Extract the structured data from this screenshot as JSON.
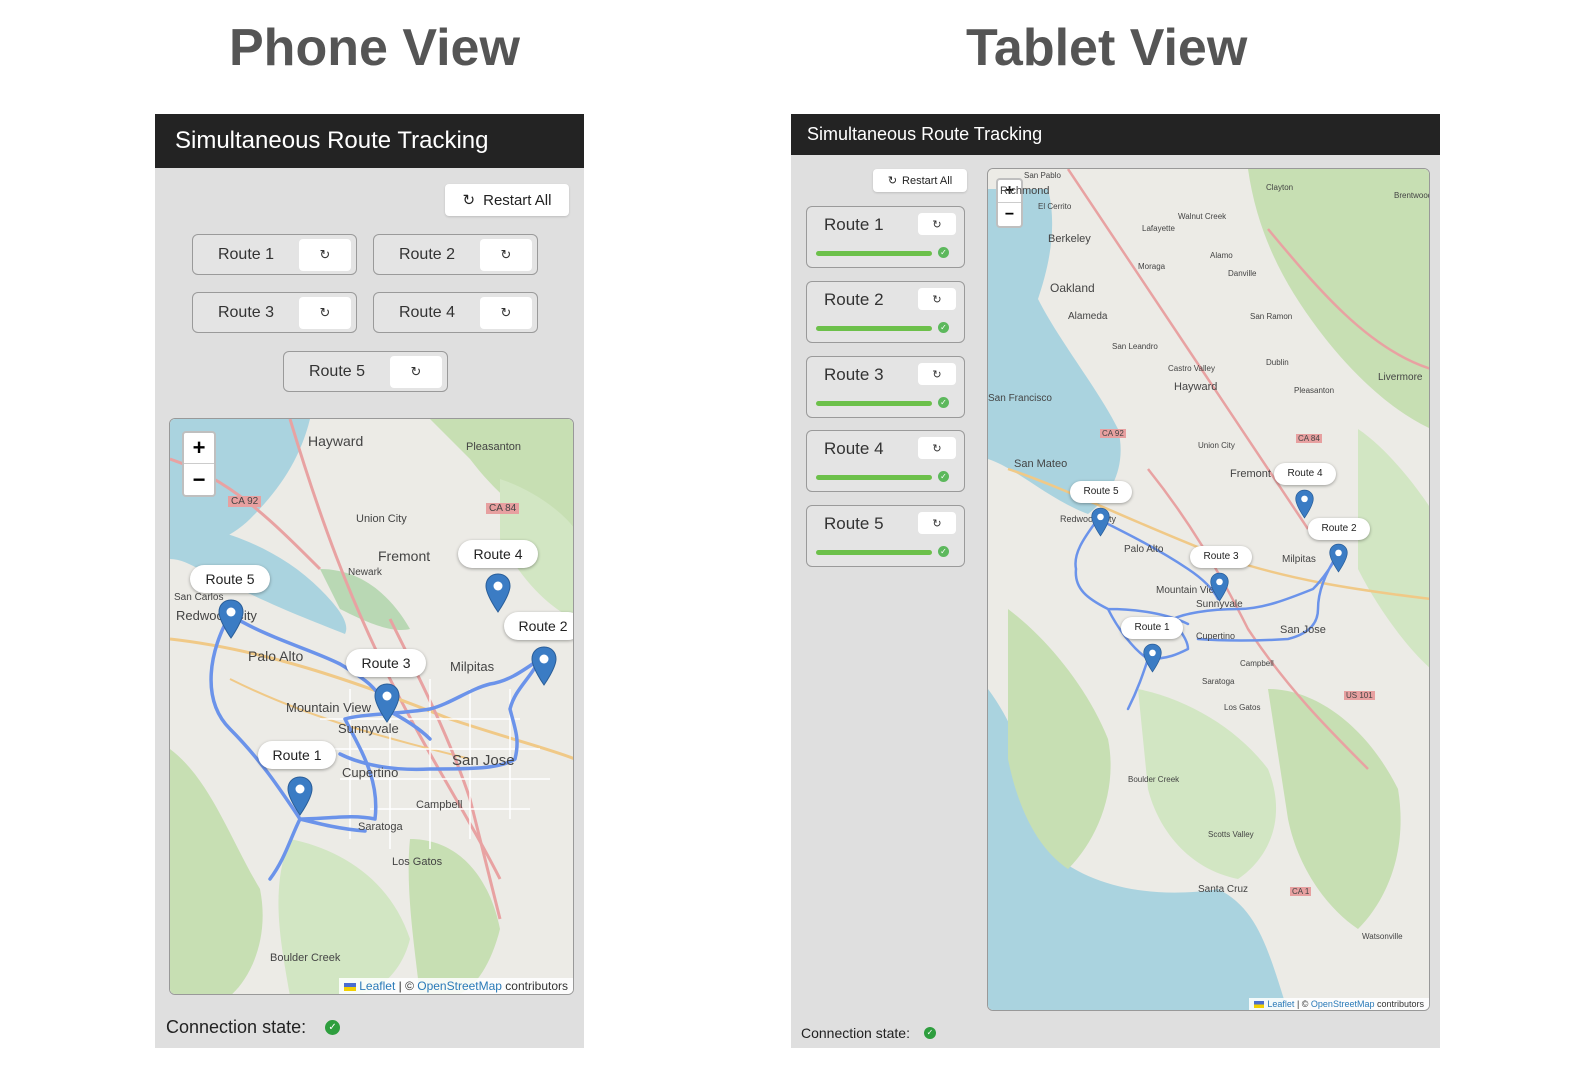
{
  "colors": {
    "appbar": "#232323",
    "device_bg": "#dfdfdf",
    "route_line": "#6b93ea",
    "pin": "#3b7cc4",
    "progress": "#6cc04a",
    "status_ok": "#2e9e3e"
  },
  "phone": {
    "view_title": "Phone View",
    "app_title": "Simultaneous Route Tracking",
    "restart_all": {
      "icon": "restart-icon",
      "label": "Restart All"
    },
    "routes": [
      {
        "label": "Route 1",
        "icon": "restart-icon"
      },
      {
        "label": "Route 2",
        "icon": "restart-icon"
      },
      {
        "label": "Route 3",
        "icon": "restart-icon"
      },
      {
        "label": "Route 4",
        "icon": "restart-icon"
      },
      {
        "label": "Route 5",
        "icon": "restart-icon"
      }
    ],
    "map": {
      "zoom_in": "+",
      "zoom_out": "−",
      "attribution": {
        "leaflet": "Leaflet",
        "sep": " | © ",
        "osm": "OpenStreetMap",
        "contributors": " contributors"
      },
      "places": [
        "Hayward",
        "Pleasanton",
        "Union City",
        "Fremont",
        "Newark",
        "Palo Alto",
        "Mountain View",
        "Sunnyvale",
        "Milpitas",
        "San Jose",
        "Cupertino",
        "Campbell",
        "Saratoga",
        "Los Gatos",
        "Boulder Creek",
        "San Carlos",
        "Redwood City",
        "CA 92",
        "CA 84"
      ],
      "pin_labels": [
        "Route 1",
        "Route 2",
        "Route 3",
        "Route 4",
        "Route 5"
      ]
    },
    "connection": {
      "label": "Connection state:",
      "status": "connected",
      "icon": "check-circle-icon"
    }
  },
  "tablet": {
    "view_title": "Tablet View",
    "app_title": "Simultaneous Route Tracking",
    "restart_all": {
      "icon": "restart-icon",
      "label": "Restart All"
    },
    "routes": [
      {
        "label": "Route 1",
        "progress": 1.0,
        "status": "complete"
      },
      {
        "label": "Route 2",
        "progress": 1.0,
        "status": "complete"
      },
      {
        "label": "Route 3",
        "progress": 1.0,
        "status": "complete"
      },
      {
        "label": "Route 4",
        "progress": 1.0,
        "status": "complete"
      },
      {
        "label": "Route 5",
        "progress": 1.0,
        "status": "complete"
      }
    ],
    "map": {
      "zoom_in": "+",
      "zoom_out": "−",
      "attribution": {
        "leaflet": "Leaflet",
        "sep": " | © ",
        "osm": "OpenStreetMap",
        "contributors": " contributors"
      },
      "places": [
        "San Pablo",
        "Richmond",
        "El Cerrito",
        "Berkeley",
        "Oakland",
        "Alameda",
        "San Leandro",
        "Castro Valley",
        "Hayward",
        "Union City",
        "Fremont",
        "San Mateo",
        "Redwood City",
        "Palo Alto",
        "Mountain View",
        "Sunnyvale",
        "Milpitas",
        "San Jose",
        "Cupertino",
        "Campbell",
        "Saratoga",
        "Los Gatos",
        "Boulder Creek",
        "Scotts Valley",
        "Santa Cruz",
        "Watsonville",
        "Livermore",
        "Pleasanton",
        "Dublin",
        "San Ramon",
        "Danville",
        "Alamo",
        "Clayton",
        "Brentwood",
        "Walnut Creek",
        "Lafayette",
        "Moraga",
        "San Francisco",
        "CA 92",
        "CA 84",
        "US 101",
        "CA 1"
      ],
      "pin_labels": [
        "Route 1",
        "Route 2",
        "Route 3",
        "Route 4",
        "Route 5"
      ]
    },
    "connection": {
      "label": "Connection state:",
      "status": "connected",
      "icon": "check-circle-icon"
    }
  }
}
